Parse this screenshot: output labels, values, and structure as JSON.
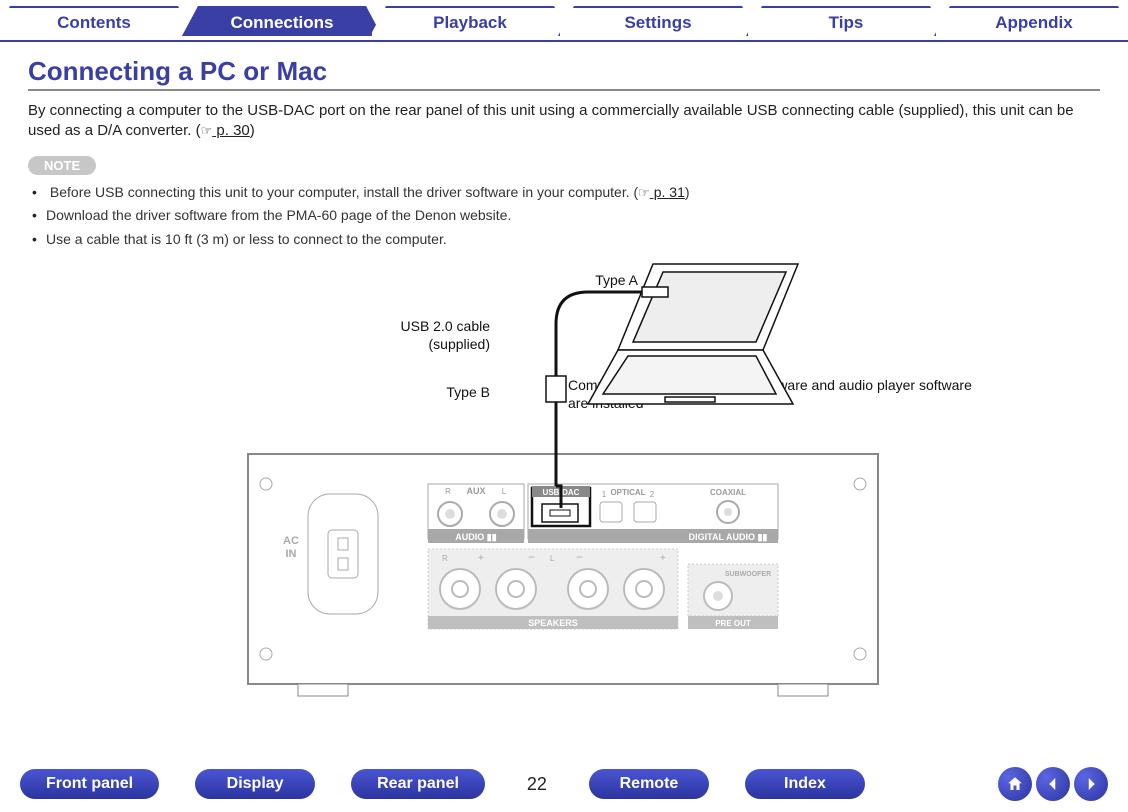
{
  "top_tabs": {
    "contents": "Contents",
    "connections": "Connections",
    "playback": "Playback",
    "settings": "Settings",
    "tips": "Tips",
    "appendix": "Appendix",
    "active": "connections"
  },
  "title": "Connecting a PC or Mac",
  "intro": {
    "pre": "By connecting a computer to the USB-DAC port on the rear panel of this unit using a commercially available USB connecting cable (supplied), this unit can be used as a D/A converter.  (",
    "link": " p. 30",
    "post": ")"
  },
  "note_label": "NOTE",
  "notes": {
    "n1_pre": "Before USB connecting this unit to your computer, install the driver software in your computer.  (",
    "n1_link": " p. 31",
    "n1_post": ")",
    "n2": "Download the driver software from the PMA-60 page of the Denon website.",
    "n3": "Use a cable that is 10 ft (3 m) or less to connect to the computer."
  },
  "diagram": {
    "type_a": "Type A",
    "cable_line1": "USB 2.0 cable",
    "cable_line2": "(supplied)",
    "type_b": "Type B",
    "computer_desc": "Computer on which the driver software and audio player software are installed",
    "rear": {
      "ac_in": "AC\nIN",
      "aux": "AUX",
      "aux_r": "R",
      "aux_l": "L",
      "audio_in": "AUDIO",
      "usb_dac": "USB-DAC",
      "opt1": "1",
      "optical": "OPTICAL",
      "opt2": "2",
      "coaxial": "COAXIAL",
      "digital_audio": "DIGITAL AUDIO",
      "speakers": "SPEAKERS",
      "spk_r": "R",
      "spk_l": "L",
      "subwoofer": "SUBWOOFER",
      "preout": "PRE OUT"
    }
  },
  "bottom": {
    "front_panel": "Front panel",
    "display": "Display",
    "rear_panel": "Rear panel",
    "page_no": "22",
    "remote": "Remote",
    "index": "Index"
  }
}
